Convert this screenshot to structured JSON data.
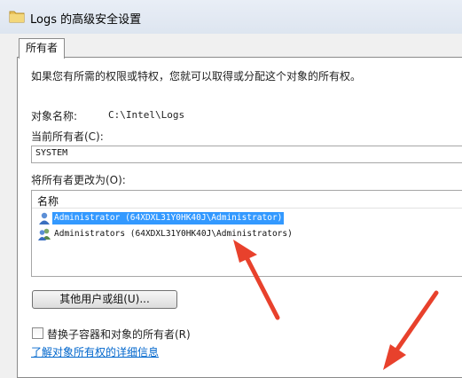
{
  "window": {
    "title": "Logs 的高级安全设置"
  },
  "tabs": [
    {
      "label": "所有者"
    }
  ],
  "description": "如果您有所需的权限或特权，您就可以取得或分配这个对象的所有权。",
  "object": {
    "label": "对象名称:",
    "value": "C:\\Intel\\Logs"
  },
  "current_owner": {
    "label": "当前所有者(C):",
    "value": "SYSTEM"
  },
  "change_owner": {
    "label": "将所有者更改为(O):",
    "column_header": "名称",
    "items": [
      {
        "label": "Administrator (64XDXL31Y0HK40J\\Administrator)",
        "selected": true,
        "icon": "user-icon"
      },
      {
        "label": "Administrators (64XDXL31Y0HK40J\\Administrators)",
        "selected": false,
        "icon": "users-group-icon"
      }
    ]
  },
  "other_users_button": "其他用户或组(U)...",
  "replace_owner_checkbox": {
    "label": "替换子容器和对象的所有者(R)",
    "checked": false
  },
  "details_link": "了解对象所有权的详细信息",
  "colors": {
    "selection": "#3399ff",
    "link": "#0066cc",
    "arrow": "#e8412c"
  }
}
